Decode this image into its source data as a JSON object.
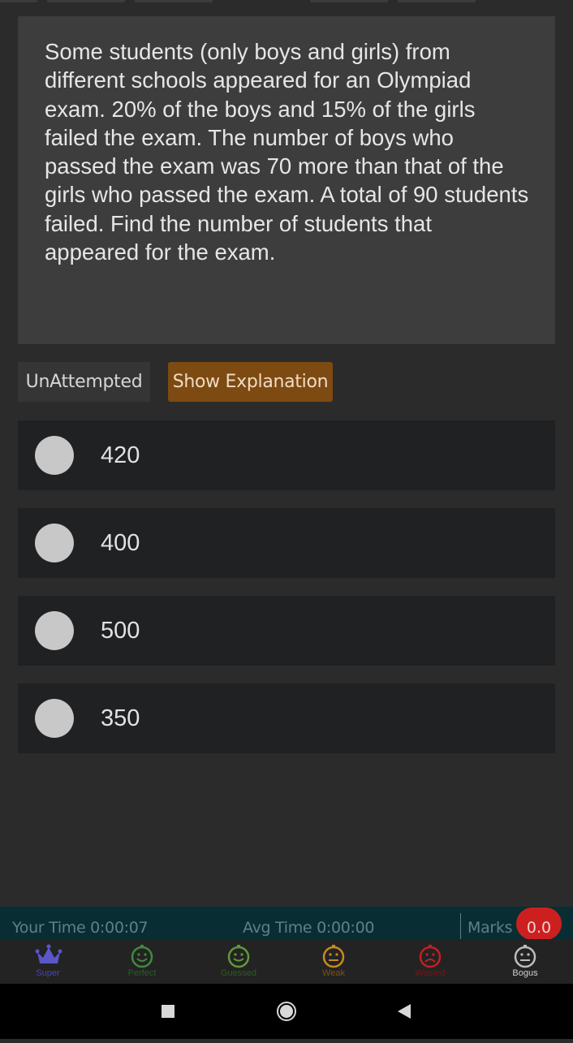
{
  "question": {
    "text": "Some students (only boys and girls) from different schools appeared for an Olympiad exam. 20% of the boys and 15% of the girls failed the exam. The number of boys who passed the exam was 70 more than that of the girls who passed the exam. A total of 90 students failed. Find the number of students that appeared for the exam."
  },
  "status": {
    "label": "UnAttempted"
  },
  "explanation_button": {
    "label": "Show Explanation"
  },
  "options": [
    {
      "label": "420"
    },
    {
      "label": "400"
    },
    {
      "label": "500"
    },
    {
      "label": "350"
    }
  ],
  "time_bar": {
    "your_time": "Your Time 0:00:07",
    "avg_time": "Avg Time 0:00:00",
    "marks_label": "Marks",
    "marks_value": "0.0"
  },
  "bottom_tabs": [
    {
      "label": "Super",
      "icon": "crown-icon",
      "color": "#5b56c9"
    },
    {
      "label": "Perfect",
      "icon": "smile-icon",
      "color": "#3f8a3a"
    },
    {
      "label": "Guessed",
      "icon": "smile-icon",
      "color": "#5e9a3a"
    },
    {
      "label": "Weak",
      "icon": "neutral-face-icon",
      "color": "#c98a1e"
    },
    {
      "label": "Wasted",
      "icon": "sad-face-icon",
      "color": "#c42020"
    },
    {
      "label": "Bogus",
      "icon": "neutral-face-icon",
      "color": "#bdbdbd"
    }
  ]
}
